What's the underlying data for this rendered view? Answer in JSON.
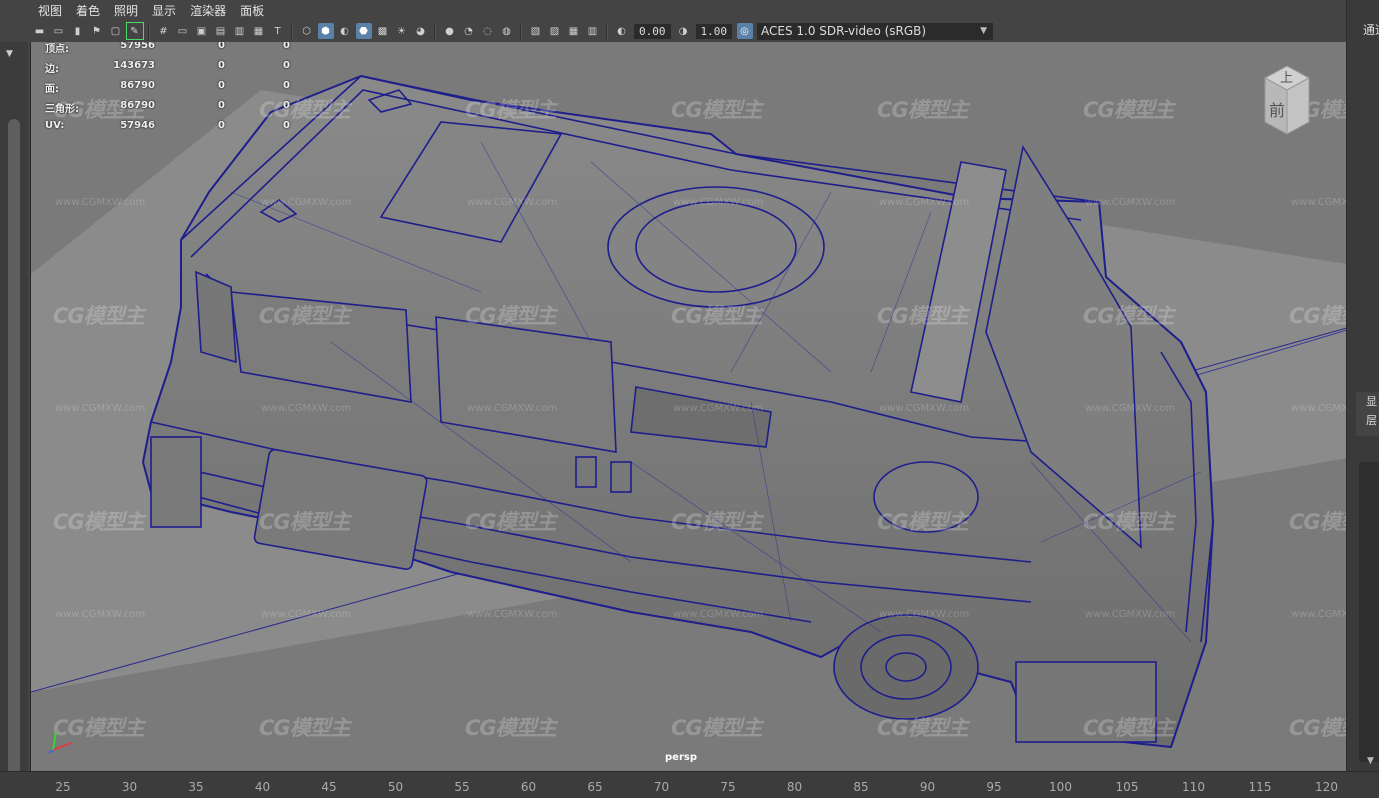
{
  "menubar": {
    "items": [
      "视图",
      "着色",
      "照明",
      "显示",
      "渲染器",
      "面板"
    ]
  },
  "toolbar": {
    "exposure": "0.00",
    "gamma": "1.00",
    "color_space": "ACES 1.0 SDR-video (sRGB)",
    "icons": [
      "camera-icon",
      "camera-attr-icon",
      "bookmark-icon",
      "camera-bookmark-icon",
      "image-plane-icon",
      "grease-pencil-icon",
      "grid-icon",
      "film-gate-icon",
      "resolution-gate-icon",
      "gate-mask-icon",
      "field-chart-icon",
      "safe-action-icon",
      "safe-title-icon",
      "wireframe-icon",
      "smooth-shade-icon",
      "default-material-icon",
      "wireframe-on-shaded-icon",
      "textured-icon",
      "use-all-lights-icon",
      "shadows-icon",
      "screen-space-ao-icon",
      "motion-blur-icon",
      "multisample-aa-icon",
      "depth-of-field-icon",
      "isolate-select-icon",
      "xray-icon",
      "xray-active-icon",
      "xray-joints-icon"
    ]
  },
  "hud": {
    "rows": [
      {
        "label": "顶点:",
        "v1": "57956",
        "v2": "0",
        "v3": "0"
      },
      {
        "label": "边:",
        "v1": "143673",
        "v2": "0",
        "v3": "0"
      },
      {
        "label": "面:",
        "v1": "86790",
        "v2": "0",
        "v3": "0"
      },
      {
        "label": "三角形:",
        "v1": "86790",
        "v2": "0",
        "v3": "0"
      },
      {
        "label": "UV:",
        "v1": "57946",
        "v2": "0",
        "v3": "0"
      }
    ]
  },
  "viewcube": {
    "top": "上",
    "front": "前"
  },
  "camera_label": "persp",
  "watermark": {
    "text": "CG模型主",
    "url": "www.CGMXW.com"
  },
  "right_panel": {
    "tab": "通道",
    "labels": [
      "显",
      "层"
    ]
  },
  "timeline": {
    "ticks": [
      "25",
      "30",
      "35",
      "40",
      "45",
      "50",
      "55",
      "60",
      "65",
      "70",
      "75",
      "80",
      "85",
      "90",
      "95",
      "100",
      "105",
      "110",
      "115",
      "120"
    ]
  }
}
